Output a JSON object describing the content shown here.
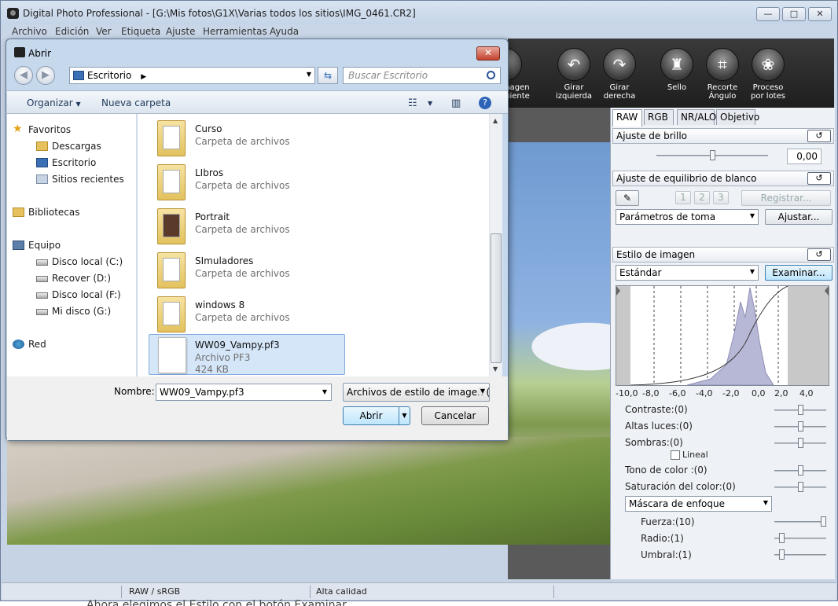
{
  "window": {
    "title": "Digital Photo Professional - [G:\\Mis fotos\\G1X\\Varias todos los sitios\\IMG_0461.CR2]",
    "min": "—",
    "max": "□",
    "close": "✕"
  },
  "menu": [
    "Archivo",
    "Edición",
    "Ver",
    "Etiqueta",
    "Ajuste",
    "Herramientas",
    "Ayuda"
  ],
  "toolbar": {
    "items": [
      {
        "label": "nagen\nuiente",
        "icon": "chevron-down-icon"
      },
      {
        "label": "Girar izquierda",
        "icon": "rotate-left-icon"
      },
      {
        "label": "Girar derecha",
        "icon": "rotate-right-icon"
      },
      {
        "label": "Sello",
        "icon": "stamp-icon"
      },
      {
        "label": "Recorte\nÁngulo",
        "icon": "crop-icon"
      },
      {
        "label": "Proceso\npor lotes",
        "icon": "batch-icon"
      }
    ]
  },
  "panel": {
    "tabs": [
      "RAW",
      "RGB",
      "NR/ALO",
      "Objetivo"
    ],
    "brightness": {
      "title": "Ajuste de brillo",
      "value": "0,00",
      "level": 0.5
    },
    "white_balance": {
      "title": "Ajuste de equilibrio de blanco",
      "presets": [
        "1",
        "2",
        "3"
      ],
      "register": "Registrar...",
      "mode": "Parámetros de toma",
      "adjust": "Ajustar..."
    },
    "picture_style": {
      "title": "Estilo de imagen",
      "style": "Estándar",
      "browse": "Examinar...",
      "axis": [
        "-10,0",
        "-8,0",
        "-6,0",
        "-4,0",
        "-2,0",
        "0,0",
        "2,0",
        "4,0"
      ]
    },
    "params": [
      {
        "label": "Contraste:(0)",
        "level": 0.5
      },
      {
        "label": "Altas luces:(0)",
        "level": 0.5
      },
      {
        "label": "Sombras:(0)",
        "level": 0.5
      },
      {
        "label": "Tono de color :(0)",
        "level": 0.5
      },
      {
        "label": "Saturación del color:(0)",
        "level": 0.5
      }
    ],
    "linear": "Lineal",
    "sharpen": {
      "mode": "Máscara de enfoque",
      "items": [
        {
          "label": "Fuerza:(10)",
          "level": 1.0
        },
        {
          "label": "Radio:(1)",
          "level": 0.1
        },
        {
          "label": "Umbral:(1)",
          "level": 0.1
        }
      ]
    },
    "reset_icon": "↺"
  },
  "status": {
    "colorspace": "RAW / sRGB",
    "quality": "Alta calidad"
  },
  "below_text": "Ahora elegimos el Estilo con el botón Examinar",
  "dialog": {
    "title": "Abrir",
    "close": "✕",
    "back": "◀",
    "forward": "▶",
    "address": "Escritorio",
    "search_placeholder": "Buscar Escritorio",
    "organize": "Organizar",
    "new_folder": "Nueva carpeta",
    "nav": {
      "favorites": "Favoritos",
      "fav_items": [
        "Descargas",
        "Escritorio",
        "Sitios recientes"
      ],
      "libraries": "Bibliotecas",
      "computer": "Equipo",
      "drives": [
        "Disco local (C:)",
        "Recover (D:)",
        "Disco local (F:)",
        "Mi disco (G:)"
      ],
      "network": "Red"
    },
    "files": [
      {
        "name": "Curso",
        "type": "Carpeta de archivos"
      },
      {
        "name": "LIbros",
        "type": "Carpeta de archivos"
      },
      {
        "name": "Portrait",
        "type": "Carpeta de archivos"
      },
      {
        "name": "SImuladores",
        "type": "Carpeta de archivos"
      },
      {
        "name": "windows 8",
        "type": "Carpeta de archivos"
      },
      {
        "name": "WW09_Vampy.pf3",
        "type": "Archivo PF3",
        "size": "424 KB"
      }
    ],
    "name_label": "Nombre:",
    "name_value": "WW09_Vampy.pf3",
    "filter": "Archivos de estilo de imagen (*",
    "open": "Abrir",
    "cancel": "Cancelar"
  }
}
